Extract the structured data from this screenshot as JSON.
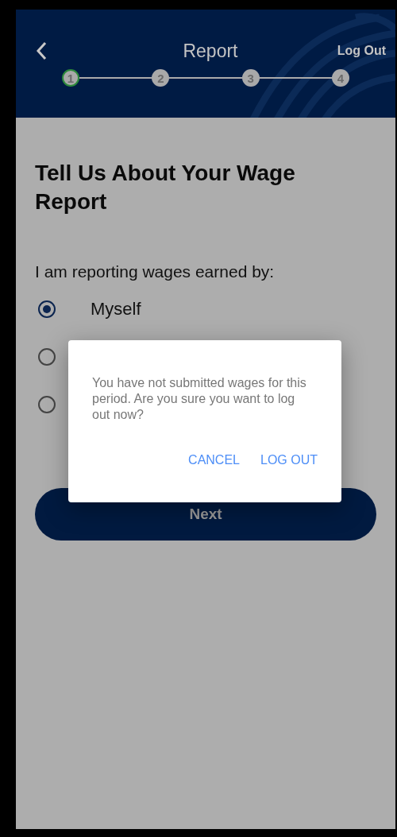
{
  "header": {
    "title": "Report",
    "logout": "Log Out"
  },
  "steps": [
    {
      "label": "1",
      "selected": true
    },
    {
      "label": "2",
      "selected": false
    },
    {
      "label": "3",
      "selected": false
    },
    {
      "label": "4",
      "selected": false
    }
  ],
  "heading": "Tell Us About Your Wage Report",
  "question": "I am reporting wages earned by:",
  "options": [
    {
      "label": "Myself",
      "selected": true
    },
    {
      "selected": false
    },
    {
      "selected": false
    }
  ],
  "next_button": "Next",
  "dialog": {
    "message": "You have not submitted wages for this period. Are you sure you want to log out now?",
    "buttons": [
      "CANCEL",
      "LOG OUT"
    ]
  }
}
